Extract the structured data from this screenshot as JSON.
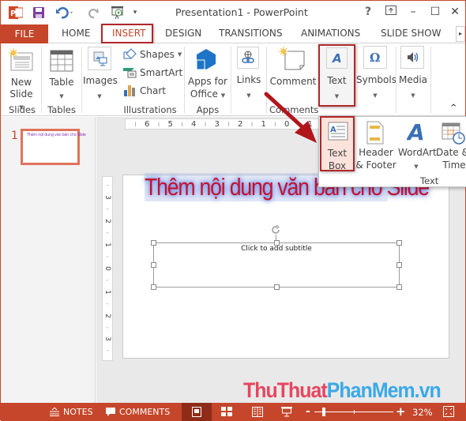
{
  "app": {
    "title": "Presentation1 - PowerPoint",
    "accent_color": "#c5462a",
    "highlight_color": "#b0262a"
  },
  "titlebar": {
    "help": "?",
    "restore_ribbon": "⧉",
    "minimize": "–",
    "maximize": "☐",
    "close": "✕"
  },
  "tabs": {
    "file": "FILE",
    "items": [
      "HOME",
      "INSERT",
      "DESIGN",
      "TRANSITIONS",
      "ANIMATIONS",
      "SLIDE SHOW"
    ],
    "active": "INSERT",
    "scroll": "▸"
  },
  "ribbon": {
    "groups": [
      {
        "name": "Slides",
        "buttons": [
          {
            "label1": "New",
            "label2": "Slide"
          }
        ]
      },
      {
        "name": "Tables",
        "buttons": [
          {
            "label1": "Table"
          }
        ]
      },
      {
        "name": "Illustrations",
        "buttons": [
          {
            "label1": "Images"
          }
        ],
        "small": [
          "Shapes",
          "SmartArt",
          "Chart"
        ]
      },
      {
        "name": "Apps",
        "buttons": [
          {
            "label1": "Apps for",
            "label2": "Office"
          }
        ]
      },
      {
        "name": "",
        "buttons": [
          {
            "label1": "Links"
          }
        ]
      },
      {
        "name": "Comments",
        "buttons": [
          {
            "label1": "Comment"
          }
        ]
      },
      {
        "name": "",
        "buttons": [
          {
            "label1": "Text"
          }
        ]
      },
      {
        "name": "",
        "buttons": [
          {
            "label1": "Symbols"
          }
        ]
      },
      {
        "name": "",
        "buttons": [
          {
            "label1": "Media"
          }
        ]
      }
    ],
    "collapse": "^"
  },
  "text_dropdown": {
    "group_label": "Text",
    "items": [
      {
        "label1": "Text",
        "label2": "Box"
      },
      {
        "label1": "Header",
        "label2": "& Footer"
      },
      {
        "label1": "WordArt",
        "label2": "▾"
      },
      {
        "label1": "Date &",
        "label2": "Time"
      }
    ]
  },
  "slides_pane": {
    "slide_number": "1",
    "thumb_text": "Thêm nội dung văn bản cho Slide"
  },
  "rulers": {
    "horizontal": [
      "6",
      "5",
      "4",
      "3",
      "2",
      "1",
      "0",
      "1"
    ],
    "vertical": [
      "3",
      "2",
      "1",
      "0",
      "1",
      "2",
      "3"
    ]
  },
  "slide": {
    "title": "Thêm nội dung văn ban cho Slide",
    "subtitle_placeholder": "Click to add subtitle"
  },
  "statusbar": {
    "notes": "NOTES",
    "comments": "COMMENTS",
    "zoom_minus": "-",
    "zoom_plus": "+",
    "zoom_percent": "32%",
    "zoom_fraction": 0.32
  },
  "watermark": {
    "part1": "ThuThuat",
    "part2": "PhanMem.vn"
  }
}
